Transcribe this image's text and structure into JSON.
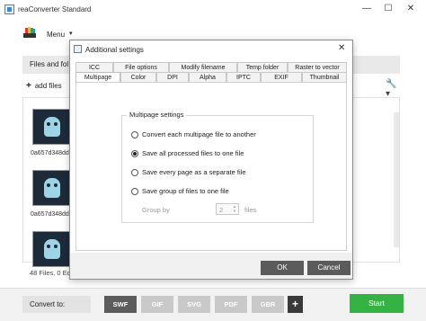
{
  "app": {
    "title": "reaConverter Standard",
    "menu_label": "Menu"
  },
  "window_controls": {
    "minimize": "—",
    "maximize": "☐",
    "close": "✕"
  },
  "tabstrip": {
    "label": "Files and fol"
  },
  "toolbar": {
    "add_label": "add files"
  },
  "files": [
    {
      "name": "0a657d348dd7"
    },
    {
      "name": "0a657d348dd7"
    },
    {
      "name": "0a657d348dd7"
    }
  ],
  "status": {
    "text": "48 Files, 0 Ed"
  },
  "bottombar": {
    "convert_to": "Convert to:",
    "formats": [
      "SWF",
      "GIF",
      "SVG",
      "PDF",
      "GBR"
    ],
    "active_format": "SWF",
    "add_format": "+",
    "start": "Start"
  },
  "dialog": {
    "title": "Additional settings",
    "close": "✕",
    "tabs_row1": [
      "ICC",
      "File options",
      "Modify filename",
      "Temp folder",
      "Raster to vector"
    ],
    "tabs_row2": [
      "Multipage",
      "Color",
      "DPI",
      "Alpha",
      "IPTC",
      "EXIF",
      "Thumbnail"
    ],
    "active_tab": "Multipage",
    "group_label": "Multipage settings",
    "options": [
      {
        "label": "Convert each multipage file to another",
        "checked": false
      },
      {
        "label": "Save all processed files to one file",
        "checked": true
      },
      {
        "label": "Save every page as a separate file",
        "checked": false
      },
      {
        "label": "Save group of files to one file",
        "checked": false
      }
    ],
    "group_by_label": "Group by",
    "group_by_value": "2",
    "files_label": "files",
    "ok": "OK",
    "cancel": "Cancel"
  },
  "colors": {
    "start_green": "#34b342",
    "dark_button": "#5b5b5b"
  }
}
